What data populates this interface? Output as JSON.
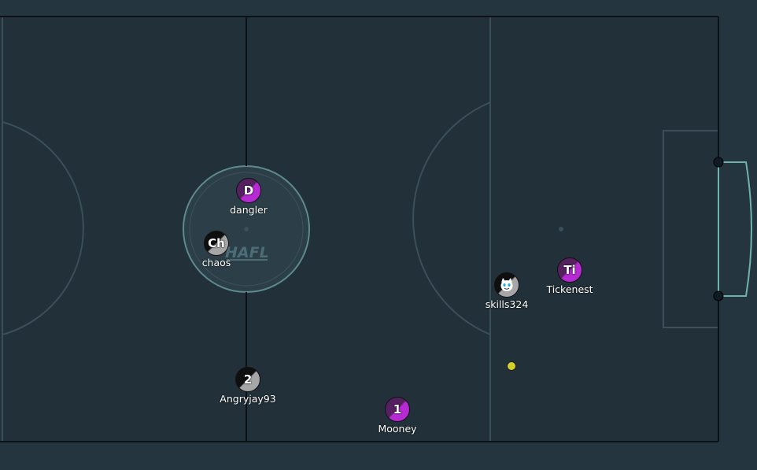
{
  "colors": {
    "background": "#253540",
    "field": "#223039",
    "field_border": "#0b1116",
    "field_lines": "#3a4f58",
    "circle_line": "#5d8a8f",
    "goal_line": "#6fb3b0",
    "red_team": "#b52ad2",
    "blue_team": "#a6a6a6",
    "ball": "#d2d02a"
  },
  "field": {
    "center_logo": "HAFL"
  },
  "players": [
    {
      "name": "dangler",
      "avatar": "D",
      "team": "purple"
    },
    {
      "name": "chaos",
      "avatar": "Ch",
      "team": "grey"
    },
    {
      "name": "Angryjay93",
      "avatar": "2",
      "team": "grey"
    },
    {
      "name": "Mooney",
      "avatar": "1",
      "team": "purple"
    },
    {
      "name": "skills324",
      "avatar": "",
      "avatar_icon": "cat-face-icon",
      "team": "grey"
    },
    {
      "name": "Tickenest",
      "avatar": "Ti",
      "team": "purple"
    }
  ]
}
